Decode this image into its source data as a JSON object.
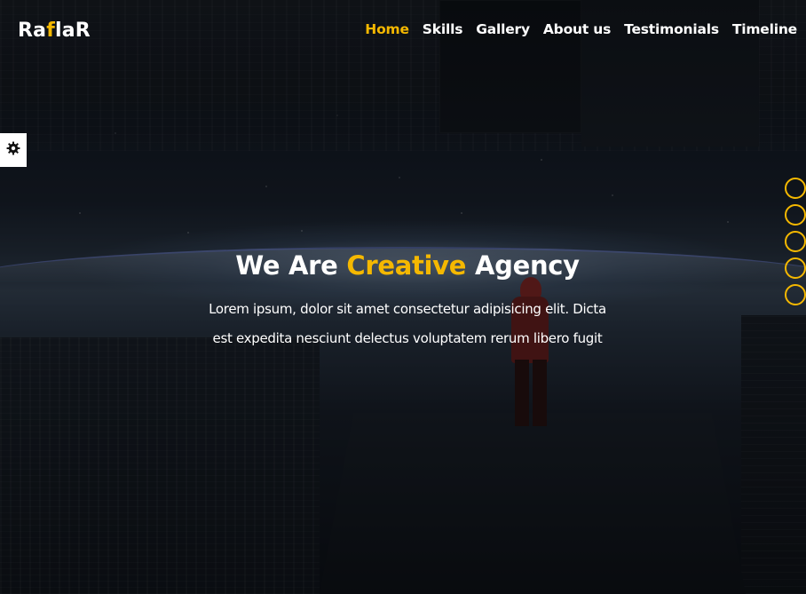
{
  "brand": {
    "logo_part1": "Ra",
    "logo_accent": "f",
    "logo_part2": "laR",
    "accent_color": "#f5b800"
  },
  "nav": {
    "items": [
      {
        "label": "Home",
        "active": true
      },
      {
        "label": "Skills",
        "active": false
      },
      {
        "label": "Gallery",
        "active": false
      },
      {
        "label": "About us",
        "active": false
      },
      {
        "label": "Testimonials",
        "active": false
      },
      {
        "label": "Timeline",
        "active": false
      }
    ]
  },
  "settings": {
    "icon": "gear-icon"
  },
  "hero": {
    "title_part1": "We Are ",
    "title_accent": "Creative",
    "title_part2": " Agency",
    "description_line1": "Lorem ipsum, dolor sit amet consectetur adipisicing elit. Dicta",
    "description_line2": "est expedita nesciunt delectus voluptatem rerum libero fugit"
  },
  "bullets": {
    "count": 5
  }
}
